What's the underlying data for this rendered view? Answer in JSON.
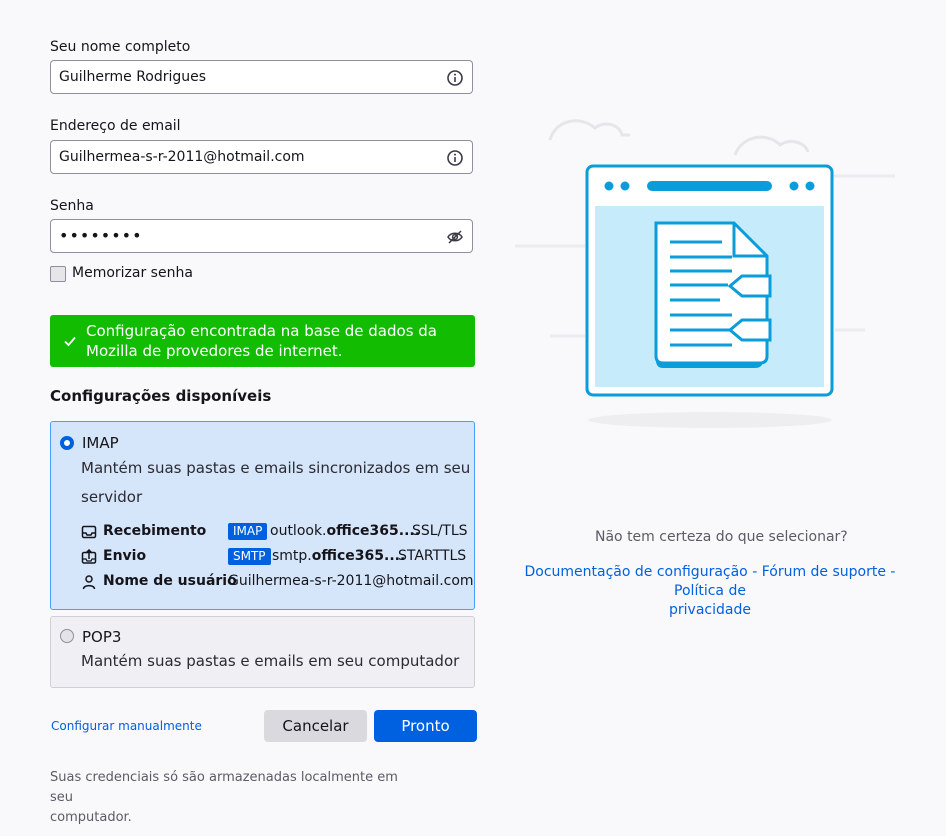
{
  "form": {
    "name_label": "Seu nome completo",
    "name_value": "Guilherme Rodrigues",
    "email_label": "Endereço de email",
    "email_value": "Guilhermea-s-r-2011@hotmail.com",
    "password_label": "Senha",
    "password_value": "••••••••",
    "remember_label": "Memorizar senha",
    "remember_checked": false
  },
  "notice": {
    "line1": "Configuração encontrada na base de dados da",
    "line2": "Mozilla de provedores de internet.",
    "color": "#12bc00"
  },
  "configs": {
    "title": "Configurações disponíveis",
    "imap": {
      "title": "IMAP",
      "desc_line1": "Mantém suas pastas e emails sincronizados em seu",
      "desc_line2": "servidor",
      "incoming_label": "Recebimento",
      "incoming_badge": "IMAP",
      "incoming_host_prefix": "outlook.",
      "incoming_host_bold": "office365....",
      "incoming_security": "SSL/TLS",
      "outgoing_label": "Envio",
      "outgoing_badge": "SMTP",
      "outgoing_host_prefix": "smtp.",
      "outgoing_host_bold": "office365....",
      "outgoing_security": "STARTTLS",
      "username_label": "Nome de usuário",
      "username_value": "Guilhermea-s-r-2011@hotmail.com",
      "selected": true
    },
    "pop3": {
      "title": "POP3",
      "desc": "Mantém suas pastas e emails em seu computador",
      "selected": false
    }
  },
  "actions": {
    "manual_label": "Configurar manualmente",
    "cancel_label": "Cancelar",
    "done_label": "Pronto"
  },
  "footnote": {
    "line1": "Suas credenciais só são armazenadas localmente em seu",
    "line2": "computador."
  },
  "help": {
    "question": "Não tem certeza do que selecionar?",
    "link_docs": "Documentação de configuração",
    "sep": " - ",
    "link_forum": "Fórum de suporte",
    "link_privacy_1": "Política de",
    "link_privacy_2": "privacidade"
  },
  "colors": {
    "accent": "#0060df",
    "illustration": "#0a9dd9",
    "illustration_fill": "#c6ecfb"
  }
}
